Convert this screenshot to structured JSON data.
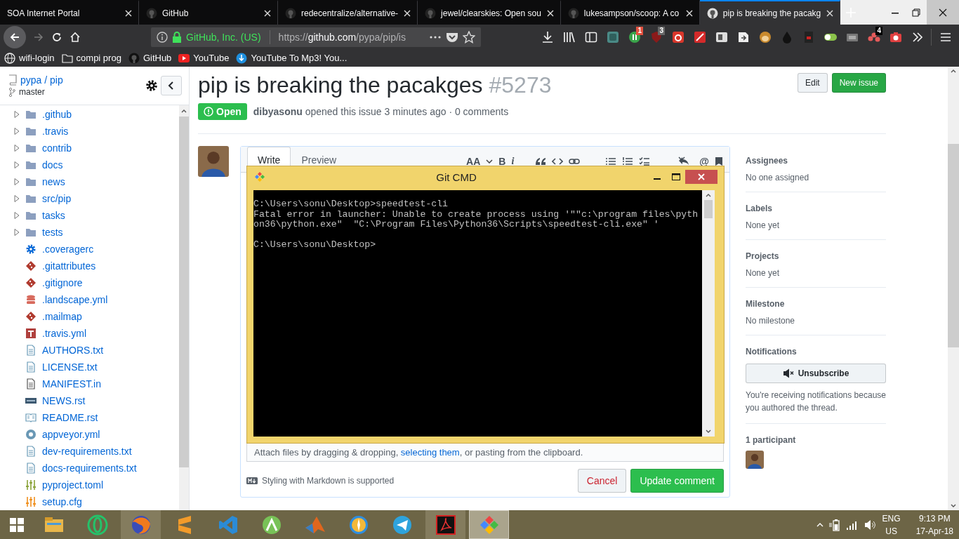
{
  "browser": {
    "tabs": [
      {
        "title": "SOA Internet Portal",
        "kind": "plain",
        "selected": false
      },
      {
        "title": "GitHub",
        "kind": "site",
        "selected": false
      },
      {
        "title": "redecentralize/alternative-",
        "kind": "site",
        "selected": false
      },
      {
        "title": "jewel/clearskies: Open sou",
        "kind": "site",
        "selected": false
      },
      {
        "title": "lukesampson/scoop: A co",
        "kind": "site",
        "selected": false
      },
      {
        "title": "pip is breaking the pacakg",
        "kind": "site",
        "selected": true
      }
    ],
    "address": {
      "identity": "GitHub, Inc. (US)",
      "scheme": "https://",
      "host": "github.com",
      "path": "/pypa/pip/is"
    },
    "extensions": [
      {
        "kind": "brace"
      },
      {
        "kind": "counter",
        "badge": "1"
      },
      {
        "kind": "shield",
        "badge": "3"
      },
      {
        "kind": "swirl"
      },
      {
        "kind": "wand"
      },
      {
        "kind": "reader"
      },
      {
        "kind": "share"
      },
      {
        "kind": "monkey"
      },
      {
        "kind": "drop"
      },
      {
        "kind": "document"
      },
      {
        "kind": "toggle"
      },
      {
        "kind": "frame"
      },
      {
        "kind": "dots",
        "badge": "4"
      },
      {
        "kind": "camera"
      }
    ],
    "bookmarks": [
      {
        "label": "wifi-login",
        "kind": "globe"
      },
      {
        "label": "compi prog",
        "kind": "folder"
      },
      {
        "label": "GitHub",
        "kind": "site"
      },
      {
        "label": "YouTube",
        "kind": "play"
      },
      {
        "label": "YouTube To Mp3! You...",
        "kind": "arrow"
      }
    ]
  },
  "repo_sidebar": {
    "owner": "pypa",
    "separator": "/",
    "repo": "pip",
    "branch": "master",
    "files": [
      {
        "name": ".github",
        "kind": "folder",
        "expanded": false
      },
      {
        "name": ".travis",
        "kind": "folder",
        "expanded": false
      },
      {
        "name": "contrib",
        "kind": "folder",
        "expanded": false
      },
      {
        "name": "docs",
        "kind": "folder",
        "expanded": false
      },
      {
        "name": "news",
        "kind": "folder",
        "expanded": false
      },
      {
        "name": "src/pip",
        "kind": "folder",
        "expanded": false
      },
      {
        "name": "tasks",
        "kind": "folder",
        "expanded": false
      },
      {
        "name": "tests",
        "kind": "folder",
        "expanded": false
      },
      {
        "name": ".coveragerc",
        "kind": "config"
      },
      {
        "name": ".gitattributes",
        "kind": "git"
      },
      {
        "name": ".gitignore",
        "kind": "git"
      },
      {
        "name": ".landscape.yml",
        "kind": "database"
      },
      {
        "name": ".mailmap",
        "kind": "git"
      },
      {
        "name": ".travis.yml",
        "kind": "tile"
      },
      {
        "name": "AUTHORS.txt",
        "kind": "text"
      },
      {
        "name": "LICENSE.txt",
        "kind": "text"
      },
      {
        "name": "MANIFEST.in",
        "kind": "plain"
      },
      {
        "name": "NEWS.rst",
        "kind": "label"
      },
      {
        "name": "README.rst",
        "kind": "book"
      },
      {
        "name": "appveyor.yml",
        "kind": "ring"
      },
      {
        "name": "dev-requirements.txt",
        "kind": "text"
      },
      {
        "name": "docs-requirements.txt",
        "kind": "text"
      },
      {
        "name": "pyproject.toml",
        "kind": "sliders"
      },
      {
        "name": "setup.cfg",
        "kind": "sliders-warm"
      }
    ]
  },
  "issue": {
    "title": "pip is breaking the pacakges",
    "number": "#5273",
    "edit_button": "Edit",
    "new_button": "New issue",
    "status": "Open",
    "meta": "**dibyasonu** opened this issue 3 minutes ago · 0 comments"
  },
  "comment_editor": {
    "tabs": [
      {
        "label": "Write",
        "selected": true
      },
      {
        "label": "Preview",
        "selected": false
      }
    ],
    "format_labels": [
      "AA",
      "B",
      "i"
    ],
    "mention_label": "@",
    "attach_hint": {
      "before": "Attach files by dragging & dropping, ",
      "link": "selecting them",
      "after": ", or pasting from the clipboard."
    },
    "markdown_note": "Styling with Markdown is supported",
    "cancel": "Cancel",
    "submit": "Update comment"
  },
  "issue_sidebar": {
    "sections": [
      {
        "heading": "Assignees",
        "value": "No one assigned"
      },
      {
        "heading": "Labels",
        "value": "None yet"
      },
      {
        "heading": "Projects",
        "value": "None yet"
      },
      {
        "heading": "Milestone",
        "value": "No milestone"
      }
    ],
    "notifications": {
      "heading": "Notifications",
      "button": "Unsubscribe",
      "reason": "You're receiving notifications because you authored the thread."
    },
    "participants": "1 participant"
  },
  "console_window": {
    "title": "Git CMD",
    "lines": [
      {
        "kind": "command",
        "text": "C:\\Users\\sonu\\Desktop>speedtest-cli"
      },
      {
        "kind": "output",
        "text": "Fatal error in launcher: Unable to create process using '\"\"c:\\program files\\pyth"
      },
      {
        "kind": "output",
        "text": "on36\\python.exe\"  \"C:\\Program Files\\Python36\\Scripts\\speedtest-cli.exe\" '"
      },
      {
        "kind": "prompt",
        "text": "C:\\Users\\sonu\\Desktop>"
      }
    ]
  },
  "taskbar": {
    "apps": [
      {
        "kind": "explorer",
        "open": false,
        "focused": false
      },
      {
        "kind": "ring",
        "open": false,
        "focused": false
      },
      {
        "kind": "fox",
        "open": true,
        "focused": false
      },
      {
        "kind": "editor",
        "open": false,
        "focused": false
      },
      {
        "kind": "code",
        "open": false,
        "focused": false
      },
      {
        "kind": "robot",
        "open": false,
        "focused": false
      },
      {
        "kind": "peak",
        "open": false,
        "focused": false
      },
      {
        "kind": "compass",
        "open": false,
        "focused": false
      },
      {
        "kind": "plane",
        "open": false,
        "focused": false
      },
      {
        "kind": "pdf",
        "open": true,
        "focused": false
      },
      {
        "kind": "diamonds",
        "open": true,
        "focused": true
      }
    ],
    "language": "ENG",
    "region": "US",
    "time": "9:13 PM",
    "date": "17-Apr-18"
  }
}
